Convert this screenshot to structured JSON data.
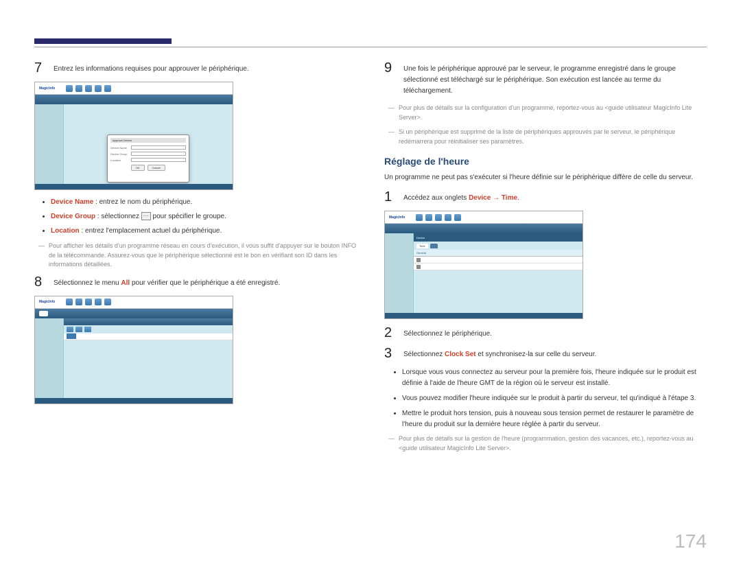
{
  "pageNumber": "174",
  "left": {
    "step7": "Entrez les informations requises pour approuver le périphérique.",
    "bullets": {
      "deviceName": {
        "label": "Device Name",
        "text": " : entrez le nom du périphérique."
      },
      "deviceGroup": {
        "label": "Device Group",
        "pre": " : sélectionnez ",
        "post": " pour spécifier le groupe."
      },
      "location": {
        "label": "Location",
        "text": " : entrez l'emplacement actuel du périphérique."
      }
    },
    "note1": "Pour afficher les détails d'un programme réseau en cours d'exécution, il vous suffit d'appuyer sur le bouton INFO de la télécommande. Assurez-vous que le périphérique sélectionné est le bon en vérifiant son ID dans les informations détaillées.",
    "step8": {
      "pre": "Sélectionnez le menu ",
      "menu": "All",
      "post": " pour vérifier que le périphérique a été enregistré."
    }
  },
  "right": {
    "step9": "Une fois le périphérique approuvé par le serveur, le programme enregistré dans le groupe sélectionné est téléchargé sur le périphérique. Son exécution est lancée au terme du téléchargement.",
    "note1": "Pour plus de détails sur la configuration d'un programme, reportez-vous au <guide utilisateur MagicInfo Lite Server>.",
    "note2": "Si un périphérique est supprimé de la liste de périphériques approuvés par le serveur, le périphérique redémarrera pour réinitialiser ses paramètres.",
    "sectionTitle": "Réglage de l'heure",
    "intro": "Un programme ne peut pas s'exécuter si l'heure définie sur le périphérique diffère de celle du serveur.",
    "step1": {
      "pre": "Accédez aux onglets ",
      "deviceLabel": "Device",
      "arrow": " → ",
      "timeLabel": "Time",
      "post": "."
    },
    "step2": "Sélectionnez le périphérique.",
    "step3": {
      "pre": "Sélectionnez ",
      "label": "Clock Set",
      "post": " et synchronisez-la sur celle du serveur."
    },
    "bullets": {
      "b1": "Lorsque vous vous connectez au serveur pour la première fois, l'heure indiquée sur le produit est définie à l'aide de l'heure GMT de la région où le serveur est installé.",
      "b2": "Vous pouvez modifier l'heure indiquée sur le produit à partir du serveur, tel qu'indiqué à l'étape 3.",
      "b3": "Mettre le produit hors tension, puis à nouveau sous tension permet de restaurer le paramètre de l'heure du produit sur la dernière heure réglée à partir du serveur."
    },
    "note3": "Pour plus de détails sur la gestion de l'heure (programmation, gestion des vacances, etc.), reportez-vous au <guide utilisateur MagicInfo Lite Server>."
  },
  "screenshot": {
    "logo": "MagicInfo",
    "dialogTitle": "Approve Device",
    "dlgDeviceName": "Device Name",
    "dlgDeviceGroup": "Device Group",
    "dlgLocation": "Location",
    "okBtn": "OK",
    "cancelBtn": "Cancel",
    "deviceTab": "Device",
    "timeTab": "Time",
    "generalTab": "General"
  }
}
